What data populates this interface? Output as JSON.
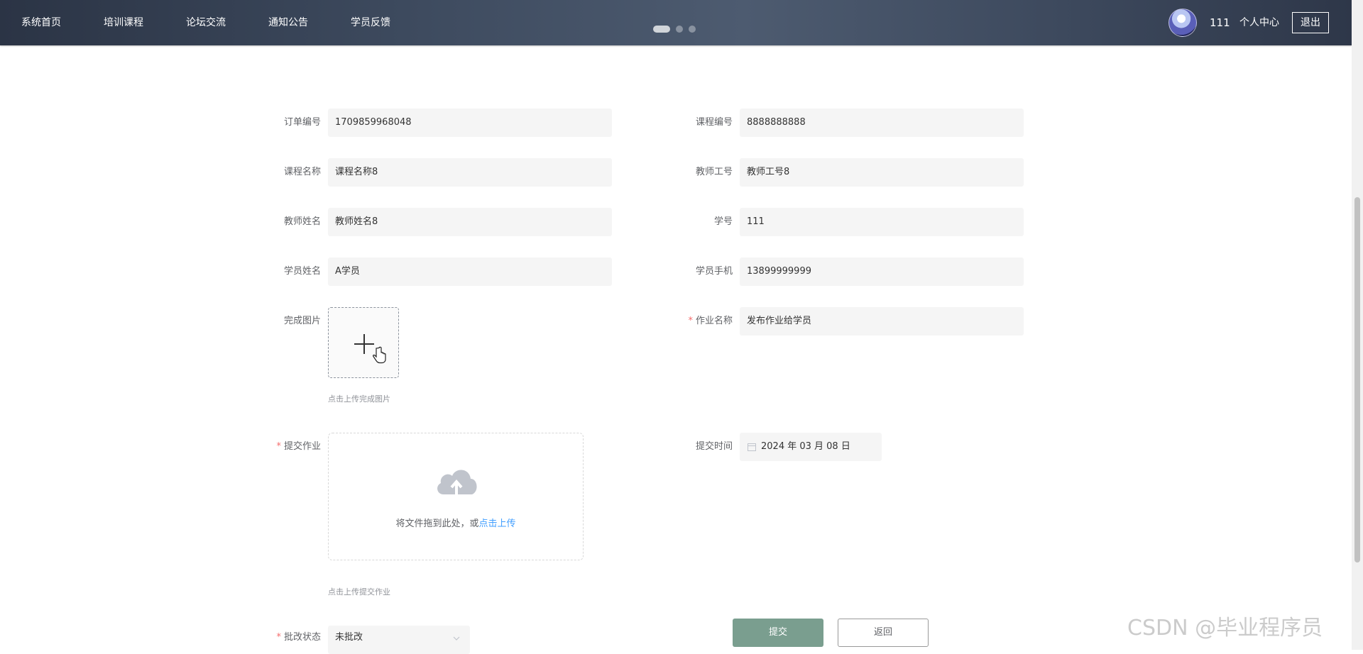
{
  "nav": {
    "items": [
      "系统首页",
      "培训课程",
      "论坛交流",
      "通知公告",
      "学员反馈"
    ],
    "username": "111",
    "user_center": "个人中心",
    "logout": "退出"
  },
  "form": {
    "order_no": {
      "label": "订单编号",
      "value": "1709859968048"
    },
    "course_no": {
      "label": "课程编号",
      "value": "8888888888"
    },
    "course_name": {
      "label": "课程名称",
      "value": "课程名称8"
    },
    "teacher_id": {
      "label": "教师工号",
      "value": "教师工号8"
    },
    "teacher_name": {
      "label": "教师姓名",
      "value": "教师姓名8"
    },
    "student_no": {
      "label": "学号",
      "value": "111"
    },
    "student_name": {
      "label": "学员姓名",
      "value": "A学员"
    },
    "student_phone": {
      "label": "学员手机",
      "value": "13899999999"
    },
    "finish_image": {
      "label": "完成图片",
      "hint": "点击上传完成图片"
    },
    "homework_name": {
      "label": "作业名称",
      "value": "发布作业给学员",
      "required": "*"
    },
    "submit_homework": {
      "label": "提交作业",
      "required": "*",
      "drop_text": "将文件拖到此处，或",
      "drop_link": "点击上传",
      "hint": "点击上传提交作业"
    },
    "submit_time": {
      "label": "提交时间",
      "value": "2024 年 03 月 08 日"
    },
    "review_status": {
      "label": "批改状态",
      "required": "*",
      "value": "未批改"
    }
  },
  "buttons": {
    "submit": "提交",
    "back": "返回"
  },
  "watermark": "CSDN @毕业程序员",
  "colors": {
    "submit_bg": "#7a9e8f",
    "required": "#f56c6c",
    "link": "#409eff"
  }
}
